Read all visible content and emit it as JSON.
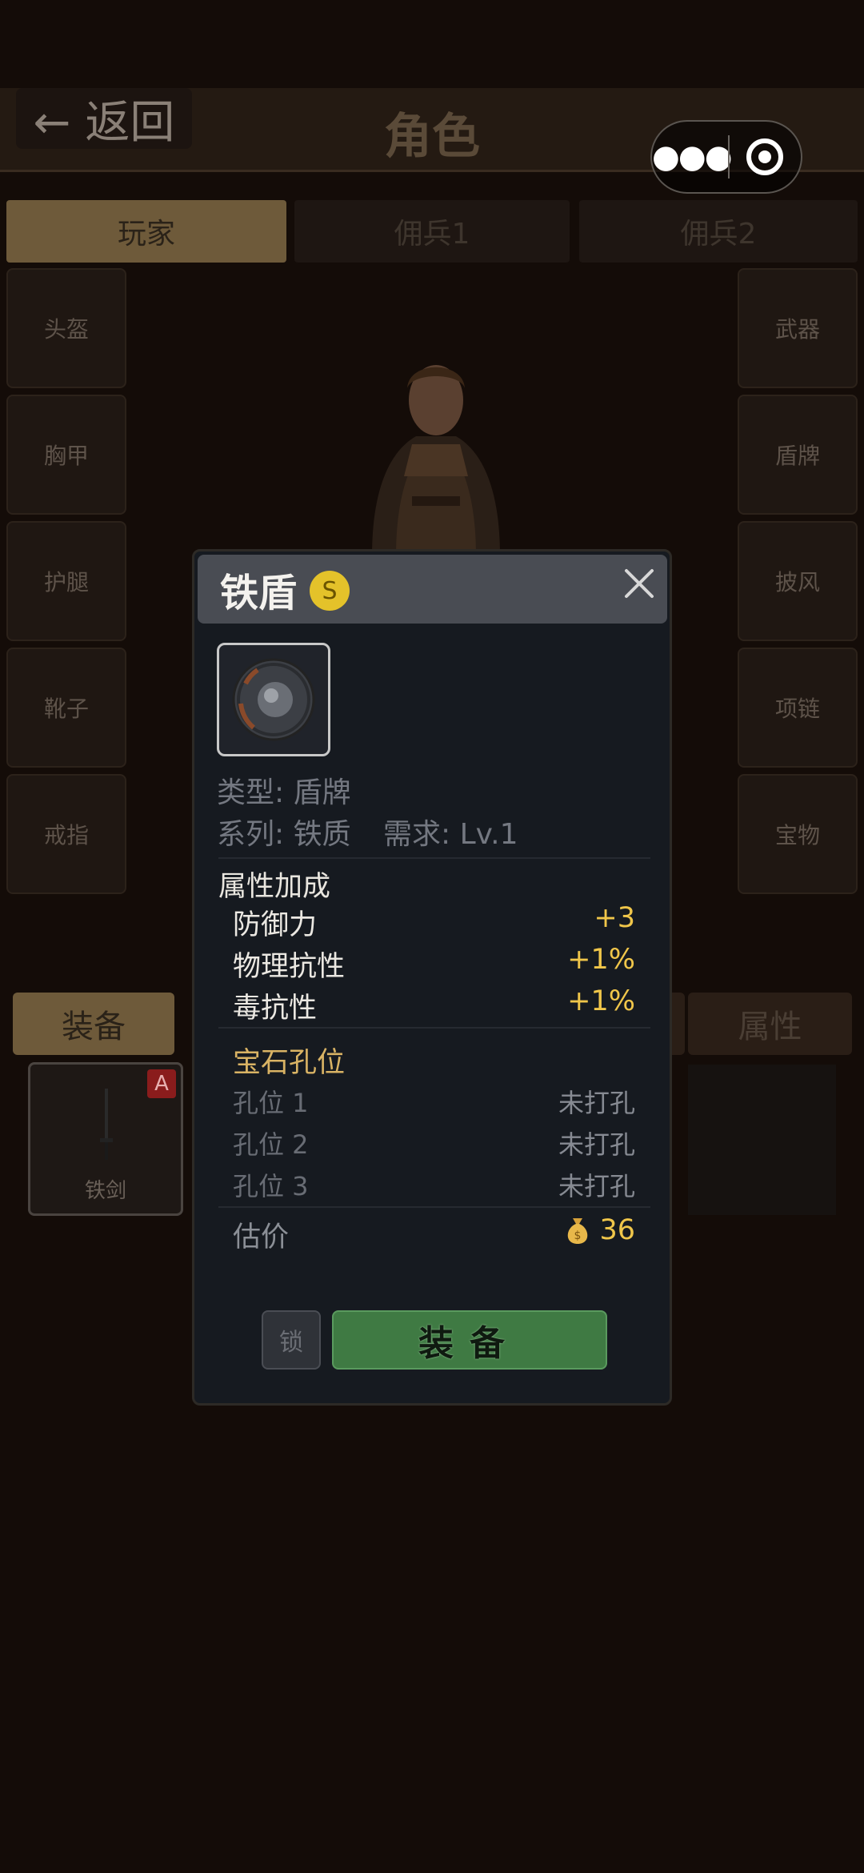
{
  "header": {
    "back_label": "← 返回",
    "title": "角色"
  },
  "tabs": [
    "玩家",
    "佣兵1",
    "佣兵2"
  ],
  "slots_left": [
    "头盔",
    "胸甲",
    "护腿",
    "靴子",
    "戒指"
  ],
  "slots_right": [
    "武器",
    "盾牌",
    "披风",
    "项链",
    "宝物"
  ],
  "bottom_tabs": {
    "equip": "装备",
    "attr": "属性"
  },
  "inventory": [
    {
      "name": "铁剑",
      "badge": "A"
    }
  ],
  "dialog": {
    "name": "铁盾",
    "rarity_mark": "S",
    "rarity_color": "#e4c22a",
    "type_line": "类型: 盾牌",
    "series_line": "系列: 铁质",
    "req_line": "需求: Lv.1",
    "attr_heading": "属性加成",
    "attrs": [
      {
        "label": "防御力",
        "value": "+3"
      },
      {
        "label": "物理抗性",
        "value": "+1%"
      },
      {
        "label": "毒抗性",
        "value": "+1%"
      }
    ],
    "gem_heading": "宝石孔位",
    "gems": [
      {
        "label": "孔位 1",
        "value": "未打孔"
      },
      {
        "label": "孔位 2",
        "value": "未打孔"
      },
      {
        "label": "孔位 3",
        "value": "未打孔"
      }
    ],
    "price_label": "估价",
    "price_icon": "money-bag-icon",
    "price_value": "36",
    "lock_label": "锁",
    "equip_label": "装备"
  },
  "colors": {
    "accent_gold": "#f0c64a",
    "equip_green": "#3f7a43",
    "tab_active": "#6e5a3a"
  }
}
